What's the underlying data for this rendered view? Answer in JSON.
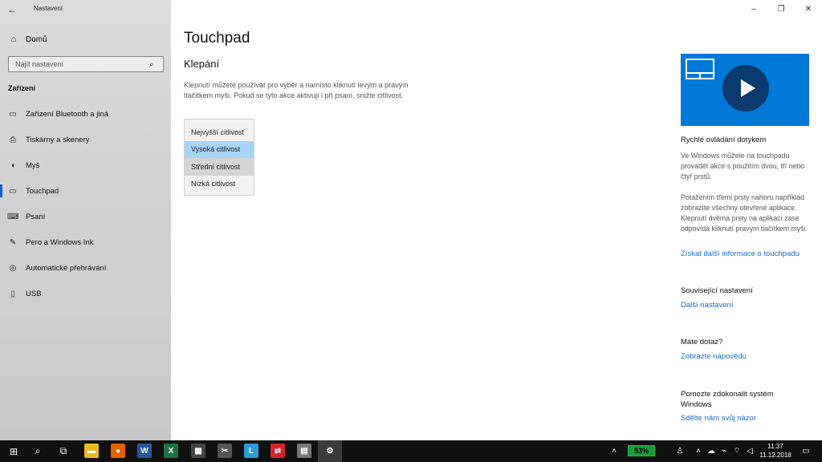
{
  "sidebar": {
    "back_icon": "back-arrow-icon",
    "app_title": "Nastavení",
    "home_label": "Domů",
    "search_placeholder": "Najít nastavení",
    "section_label": "Zařízení",
    "items": [
      {
        "label": "Zařízení Bluetooth a jiná",
        "icon": "bluetooth-devices-icon",
        "glyph": "▭"
      },
      {
        "label": "Tiskárny a skenery",
        "icon": "printer-icon",
        "glyph": "⎙"
      },
      {
        "label": "Myš",
        "icon": "mouse-icon",
        "glyph": "◖"
      },
      {
        "label": "Touchpad",
        "icon": "touchpad-icon",
        "glyph": "▭",
        "active": true
      },
      {
        "label": "Psaní",
        "icon": "keyboard-icon",
        "glyph": "⌨"
      },
      {
        "label": "Pero a Windows Ink",
        "icon": "pen-icon",
        "glyph": "✎"
      },
      {
        "label": "Automatické přehrávání",
        "icon": "autoplay-icon",
        "glyph": "◎"
      },
      {
        "label": "USB",
        "icon": "usb-icon",
        "glyph": "▯"
      }
    ]
  },
  "window_controls": {
    "minimize": "–",
    "restore": "❐",
    "close": "✕"
  },
  "main": {
    "title": "Touchpad",
    "section": "Klepání",
    "description": "Klepnutí můžete používat pro výběr a namísto kliknutí levým a pravým tlačítkem myši. Pokud se tyto akce aktivují i při psaní, snižte citlivost.",
    "sensitivity_options": [
      {
        "label": "Nejvyšší citlivost",
        "state": "normal"
      },
      {
        "label": "Vysoká citlivost",
        "state": "hover"
      },
      {
        "label": "Střední citlivost",
        "state": "selected"
      },
      {
        "label": "Nízká citlivost",
        "state": "normal"
      }
    ]
  },
  "right_panel": {
    "video_color": "#0078d7",
    "quick_title": "Rychlé ovládání dotykem",
    "quick_text_1": "Ve Windows můžete na touchpadu provádět akce s použitím dvou, tří nebo čtyř prstů.",
    "quick_text_2": "Potažením třemi prsty nahoru například zobrazíte všechny otevřené aplikace. Klepnutí dvěma prsty na aplikaci zase odpovídá kliknutí pravým tlačítkem myši.",
    "more_info_link": "Získat další informace o touchpadu",
    "related_title": "Související nastavení",
    "related_link": "Další nastavení",
    "question_title": "Máte dotaz?",
    "help_link": "Zobrazte nápovědu",
    "improve_title": "Pomozte zdokonalit systém Windows",
    "feedback_link": "Sdělte nám svůj názor"
  },
  "taskbar": {
    "battery": "53%",
    "time": "11:37",
    "date": "11.12.2018",
    "apps": [
      {
        "name": "file-explorer-icon",
        "glyph": "▬",
        "color": "#e8b923"
      },
      {
        "name": "firefox-icon",
        "glyph": "●",
        "color": "#e66000"
      },
      {
        "name": "word-icon",
        "glyph": "W",
        "color": "#2b5797"
      },
      {
        "name": "excel-icon",
        "glyph": "X",
        "color": "#1e7145"
      },
      {
        "name": "calculator-icon",
        "glyph": "▦",
        "color": "#444444"
      },
      {
        "name": "snipping-tool-icon",
        "glyph": "✂",
        "color": "#555555"
      },
      {
        "name": "app-l-icon",
        "glyph": "L",
        "color": "#2f9bd6"
      },
      {
        "name": "app-red-icon",
        "glyph": "⇄",
        "color": "#d0262b"
      },
      {
        "name": "app-gray-icon",
        "glyph": "▤",
        "color": "#777777"
      },
      {
        "name": "settings-icon",
        "glyph": "⚙",
        "color": "#3a3a3a"
      }
    ]
  }
}
